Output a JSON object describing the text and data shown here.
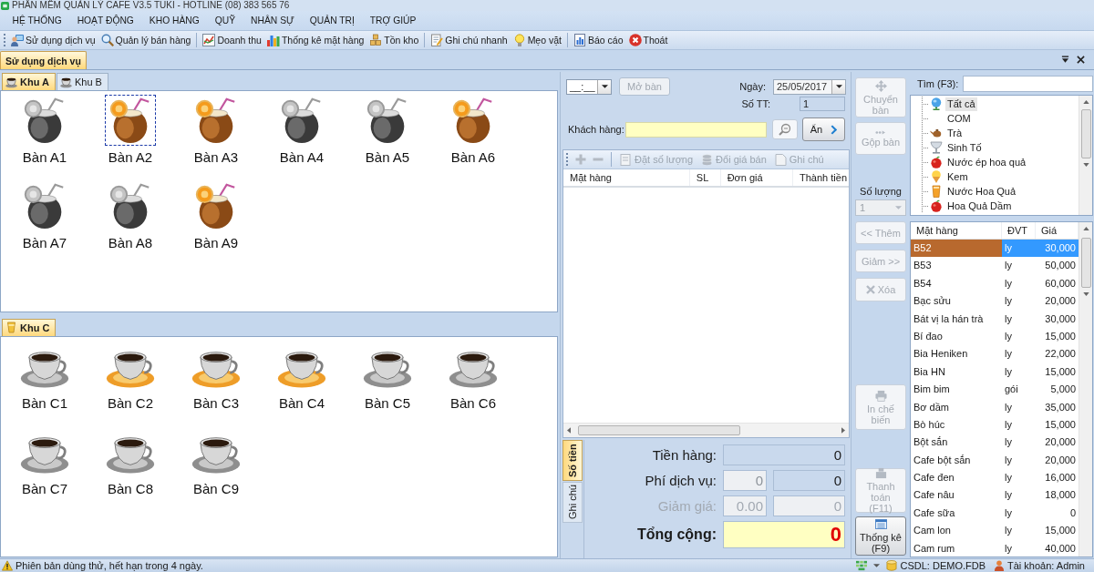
{
  "window": {
    "title": "PHẦN MỀM QUẢN LÝ CAFE V3.5 TUKI - HOTLINE (08) 383 565 76"
  },
  "menu": [
    "HỆ THỐNG",
    "HOẠT ĐỘNG",
    "KHO HÀNG",
    "QUỸ",
    "NHÂN SỰ",
    "QUẢN TRỊ",
    "TRỢ GIÚP"
  ],
  "toolbar": [
    {
      "items": [
        {
          "label": "Sử dụng dịch vụ"
        },
        {
          "label": "Quản lý bán hàng"
        }
      ]
    },
    {
      "items": [
        {
          "label": "Doanh thu"
        },
        {
          "label": "Thống kê mặt hàng"
        },
        {
          "label": "Tồn kho"
        }
      ]
    },
    {
      "items": [
        {
          "label": "Ghi chú nhanh"
        },
        {
          "label": "Mẹo vặt"
        }
      ]
    },
    {
      "items": [
        {
          "label": "Báo cáo"
        },
        {
          "label": "Thoát"
        }
      ]
    }
  ],
  "document_tabs": [
    {
      "label": "Sử dụng dịch vụ",
      "selected": true
    }
  ],
  "areas": [
    {
      "tabs": [
        {
          "label": "Khu A",
          "selected": true
        },
        {
          "label": "Khu B",
          "selected": false
        }
      ],
      "tables": [
        {
          "label": "Bàn A1",
          "occupied": false,
          "selected": false
        },
        {
          "label": "Bàn A2",
          "occupied": true,
          "selected": true
        },
        {
          "label": "Bàn A3",
          "occupied": true,
          "selected": false
        },
        {
          "label": "Bàn A4",
          "occupied": false,
          "selected": false
        },
        {
          "label": "Bàn A5",
          "occupied": false,
          "selected": false
        },
        {
          "label": "Bàn A6",
          "occupied": true,
          "selected": false
        },
        {
          "label": "Bàn A7",
          "occupied": false,
          "selected": false
        },
        {
          "label": "Bàn A8",
          "occupied": false,
          "selected": false
        },
        {
          "label": "Bàn A9",
          "occupied": true,
          "selected": false
        }
      ]
    },
    {
      "tabs": [
        {
          "label": "Khu C",
          "selected": true
        }
      ],
      "tables": [
        {
          "label": "Bàn C1",
          "occupied": false,
          "selected": false
        },
        {
          "label": "Bàn C2",
          "occupied": true,
          "selected": false
        },
        {
          "label": "Bàn C3",
          "occupied": true,
          "selected": false
        },
        {
          "label": "Bàn C4",
          "occupied": true,
          "selected": false
        },
        {
          "label": "Bàn C5",
          "occupied": false,
          "selected": false
        },
        {
          "label": "Bàn C6",
          "occupied": false,
          "selected": false
        },
        {
          "label": "Bàn C7",
          "occupied": false,
          "selected": false
        },
        {
          "label": "Bàn C8",
          "occupied": false,
          "selected": false
        },
        {
          "label": "Bàn C9",
          "occupied": false,
          "selected": false
        }
      ]
    }
  ],
  "order": {
    "time": {
      "value": "__:__"
    },
    "open_button": {
      "label": "Mở bàn",
      "disabled": true
    },
    "date": {
      "label": "Ngày:",
      "value": "25/05/2017"
    },
    "number": {
      "label": "Số TT:",
      "value": "1"
    },
    "customer": {
      "label": "Khách hàng:"
    },
    "hide_button": {
      "label": "Ẩn"
    },
    "grid_tools": {
      "icon_buttons": [
        {
          "disabled": true
        },
        {
          "disabled": true
        }
      ],
      "buttons": [
        {
          "label": "Đặt số lượng",
          "disabled": true
        },
        {
          "label": "Đổi giá bán",
          "disabled": true
        },
        {
          "label": "Ghi chú",
          "disabled": true
        }
      ]
    },
    "columns": [
      "Mặt hàng",
      "SL",
      "Đơn giá",
      "Thành tiền"
    ],
    "summary_tabs": [
      {
        "label": "Số tiền",
        "selected": true
      },
      {
        "label": "Ghi chú",
        "selected": false
      }
    ],
    "totals": {
      "subtotal": {
        "label": "Tiền hàng:",
        "value": "0"
      },
      "service": {
        "label": "Phí dịch vụ:",
        "rate": "0",
        "value": "0"
      },
      "discount": {
        "label": "Giảm giá:",
        "rate": "0.00",
        "value": "0",
        "disabled": true
      },
      "total": {
        "label": "Tổng cộng:",
        "value": "0"
      }
    }
  },
  "side_panel": {
    "table_buttons": [
      {
        "label": "Chuyển bàn",
        "disabled": true
      },
      {
        "label": "Gộp bàn",
        "disabled": true
      }
    ],
    "quantity": {
      "label": "Số lượng",
      "value": "1",
      "disabled": true
    },
    "item_buttons": [
      {
        "label": "<< Thêm",
        "disabled": true
      },
      {
        "label": "Giảm >>",
        "disabled": true
      },
      {
        "label": "Xóa",
        "disabled": true
      }
    ],
    "print_button": {
      "label": "In chế biến",
      "disabled": true
    },
    "pay_buttons": [
      {
        "label": "Thanh toán (F11)",
        "disabled": true
      },
      {
        "label": "Thống kê (F9)",
        "disabled": false
      }
    ]
  },
  "catalog": {
    "search": {
      "label": "Tìm (F3):"
    },
    "categories": [
      {
        "label": "Tất cả",
        "selected": true
      },
      {
        "label": "COM",
        "selected": false
      },
      {
        "label": "Trà",
        "selected": false
      },
      {
        "label": "Sinh Tố",
        "selected": false
      },
      {
        "label": "Nước ép hoa quả",
        "selected": false
      },
      {
        "label": "Kem",
        "selected": false
      },
      {
        "label": "Nước Hoa Quả",
        "selected": false
      },
      {
        "label": "Hoa Quả Dầm",
        "selected": false
      }
    ],
    "columns": [
      "Mặt hàng",
      "ĐVT",
      "Giá"
    ],
    "items": [
      {
        "name": "B52",
        "unit": "ly",
        "price": "30,000",
        "selected": true
      },
      {
        "name": "B53",
        "unit": "ly",
        "price": "50,000",
        "selected": false
      },
      {
        "name": "B54",
        "unit": "ly",
        "price": "60,000",
        "selected": false
      },
      {
        "name": "Bạc sửu",
        "unit": "ly",
        "price": "20,000",
        "selected": false
      },
      {
        "name": "Bát vị la hán trà",
        "unit": "ly",
        "price": "30,000",
        "selected": false
      },
      {
        "name": "Bí đao",
        "unit": "ly",
        "price": "15,000",
        "selected": false
      },
      {
        "name": "Bia Heniken",
        "unit": "ly",
        "price": "22,000",
        "selected": false
      },
      {
        "name": "Bia HN",
        "unit": "ly",
        "price": "15,000",
        "selected": false
      },
      {
        "name": "Bim bim",
        "unit": "gói",
        "price": "5,000",
        "selected": false
      },
      {
        "name": "Bơ dầm",
        "unit": "ly",
        "price": "35,000",
        "selected": false
      },
      {
        "name": "Bò húc",
        "unit": "ly",
        "price": "15,000",
        "selected": false
      },
      {
        "name": "Bột sắn",
        "unit": "ly",
        "price": "20,000",
        "selected": false
      },
      {
        "name": "Cafe bột sắn",
        "unit": "ly",
        "price": "20,000",
        "selected": false
      },
      {
        "name": "Cafe đen",
        "unit": "ly",
        "price": "16,000",
        "selected": false
      },
      {
        "name": "Cafe nâu",
        "unit": "ly",
        "price": "18,000",
        "selected": false
      },
      {
        "name": "Cafe sữa",
        "unit": "ly",
        "price": "0",
        "selected": false
      },
      {
        "name": "Cam lon",
        "unit": "ly",
        "price": "15,000",
        "selected": false
      },
      {
        "name": "Cam rum",
        "unit": "ly",
        "price": "40,000",
        "selected": false
      }
    ]
  },
  "status_bar": {
    "message": "Phiên bản dùng thử, hết hạn trong 4 ngày.",
    "database": "CSDL: DEMO.FDB",
    "account": "Tài khoản: Admin"
  }
}
